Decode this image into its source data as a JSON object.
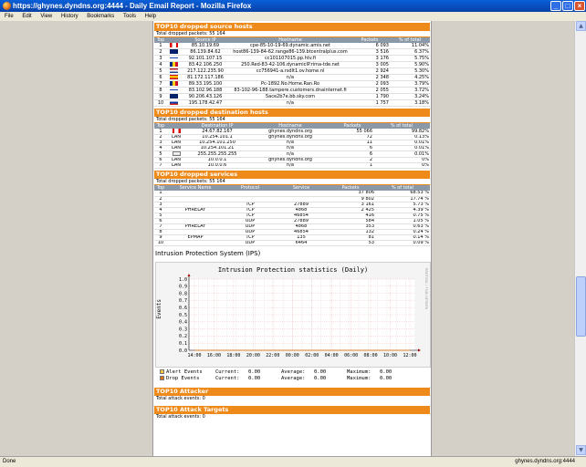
{
  "window": {
    "title": "https://ghynes.dyndns.org:4444 - Daily Email Report - Mozilla Firefox"
  },
  "menu": [
    "File",
    "Edit",
    "View",
    "History",
    "Bookmarks",
    "Tools",
    "Help"
  ],
  "status": {
    "left": "Done",
    "right": "ghynes.dyndns.org:4444"
  },
  "sources": {
    "header": "TOP10 dropped source hosts",
    "total": "Total dropped packets: 55 164",
    "columns": [
      "Top",
      "",
      "Source IP",
      "Hostname",
      "Packets",
      "% of total"
    ],
    "rows": [
      {
        "n": "1",
        "flag": "ca",
        "ip": "85.10.19.69",
        "host": "cpe-85-10-19-69.dynamic.amis.net",
        "p": "6 093",
        "pc": "11.04%"
      },
      {
        "n": "2",
        "flag": "gb",
        "ip": "86.139.84.62",
        "host": "host86-139-84-62.range86-139.btcentralplus.com",
        "p": "3 516",
        "pc": "6.37%"
      },
      {
        "n": "3",
        "flag": "fi",
        "ip": "92.101.107.15",
        "host": "cc101107015.pp.htv.fi",
        "p": "3 176",
        "pc": "5.75%"
      },
      {
        "n": "4",
        "flag": "ro",
        "ip": "83.42.106.250",
        "host": "250.Red-83-42-106.dynamicIP.rima-tde.net",
        "p": "3 005",
        "pc": "5.90%"
      },
      {
        "n": "5",
        "flag": "nl",
        "ip": "217.122.235.90",
        "host": "cc756941-a.rsdlt1.ov.home.nl",
        "p": "2 924",
        "p2": "",
        "pc": "5.30%"
      },
      {
        "n": "6",
        "flag": "es",
        "ip": "81.172.117.186",
        "host": "n/a",
        "p": "2 348",
        "pc": "4.25%"
      },
      {
        "n": "7",
        "flag": "ro",
        "ip": "89.33.195.100",
        "host": "Pc-1892.No.Home.Ran.Ro",
        "p": "2 093",
        "pc": "3.79%"
      },
      {
        "n": "8",
        "flag": "fi",
        "ip": "83.102.96.188",
        "host": "83-102-96-188.tampere.customers.dnainternet.fi",
        "p": "2 055",
        "pc": "3.72%"
      },
      {
        "n": "9",
        "flag": "gb",
        "ip": "90.206.43.126",
        "host": "5ace2b7e.bb.sky.com",
        "p": "1 790",
        "pc": "3.24%"
      },
      {
        "n": "10",
        "flag": "ru",
        "ip": "195.178.42.47",
        "host": "n/a",
        "p": "1 757",
        "pc": "3.18%"
      }
    ]
  },
  "dests": {
    "header": "TOP10 dropped destination hosts",
    "total": "Total dropped packets: 55 164",
    "columns": [
      "Top",
      "",
      "Destination IP",
      "Hostname",
      "Packets",
      "% of total"
    ],
    "rows": [
      {
        "n": "1",
        "flag": "ca",
        "ip": "24.67.82.167",
        "host": "ghynes.dyndns.org",
        "p": "55 066",
        "pc": "99.82%"
      },
      {
        "n": "2",
        "flag": "LAN",
        "ip": "10.254.101.1",
        "host": "ghynes.dyndns.org",
        "p": "72",
        "pc": "0.13%"
      },
      {
        "n": "3",
        "flag": "LAN",
        "ip": "10.254.101.250",
        "host": "n/a",
        "p": "11",
        "pc": "0.01%"
      },
      {
        "n": "4",
        "flag": "LAN",
        "ip": "10.254.101.21",
        "host": "n/a",
        "p": "6",
        "pc": "0.01%"
      },
      {
        "n": "5",
        "flag": "generic",
        "ip": "255.255.255.255",
        "host": "n/a",
        "p": "6",
        "pc": "0.01%"
      },
      {
        "n": "6",
        "flag": "LAN",
        "ip": "10.0.0.1",
        "host": "ghynes.dyndns.org",
        "p": "2",
        "pc": "0%"
      },
      {
        "n": "7",
        "flag": "LAN",
        "ip": "10.0.0.6",
        "host": "n/a",
        "p": "1",
        "pc": "0%"
      }
    ]
  },
  "services": {
    "header": "TOP10 dropped services",
    "total": "Total dropped packets: 55 164",
    "columns": [
      "Top",
      "Service Name",
      "Protocol",
      "Service",
      "Packets",
      "% of total"
    ],
    "rows": [
      {
        "n": "1",
        "name": "",
        "proto": "",
        "svc": "",
        "p": "37 806",
        "pc": "68.53 %"
      },
      {
        "n": "2",
        "name": "",
        "proto": "",
        "svc": "",
        "p": "9 802",
        "pc": "17.74 %"
      },
      {
        "n": "3",
        "name": "",
        "proto": "TCP",
        "svc": "27889",
        "p": "3 161",
        "pc": "5.73 %"
      },
      {
        "n": "4",
        "name": "PHRELAY",
        "proto": "TCP",
        "svc": "4868",
        "p": "2 425",
        "pc": "4.39 %"
      },
      {
        "n": "5",
        "name": "",
        "proto": "TCP",
        "svc": "46854",
        "p": "416",
        "pc": "0.75 %"
      },
      {
        "n": "6",
        "name": "",
        "proto": "UDP",
        "svc": "27889",
        "p": "584",
        "pc": "1.05 %"
      },
      {
        "n": "7",
        "name": "PHRELAY",
        "proto": "UDP",
        "svc": "4868",
        "p": "353",
        "pc": "0.63 %"
      },
      {
        "n": "8",
        "name": "",
        "proto": "UDP",
        "svc": "46854",
        "p": "132",
        "pc": "0.24 %"
      },
      {
        "n": "9",
        "name": "EPMAP",
        "proto": "TCP",
        "svc": "135",
        "p": "81",
        "pc": "0.14 %"
      },
      {
        "n": "10",
        "name": "",
        "proto": "UDP",
        "svc": "6464",
        "p": "53",
        "pc": "0.09 %"
      }
    ]
  },
  "ips": {
    "caption": "Intrusion Protection System (IPS)"
  },
  "chart_data": {
    "type": "line",
    "title": "Intrusion Protection statistics (Daily)",
    "ylabel": "Events",
    "side_label": "RRDTOOL / TOBI OETIKER",
    "x": [
      "14:00",
      "16:00",
      "18:00",
      "20:00",
      "22:00",
      "00:00",
      "02:00",
      "04:00",
      "06:00",
      "08:00",
      "10:00",
      "12:00"
    ],
    "yticks": [
      "1.0",
      "0.9",
      "0.8",
      "0.7",
      "0.6",
      "0.5",
      "0.4",
      "0.3",
      "0.2",
      "0.1",
      "0.0"
    ],
    "ylim": [
      0,
      1
    ],
    "series": [
      {
        "name": "Alert Events",
        "color": "#f5c542",
        "values": [
          0,
          0,
          0,
          0,
          0,
          0,
          0,
          0,
          0,
          0,
          0,
          0
        ]
      },
      {
        "name": "Drop Events",
        "color": "#d9741c",
        "values": [
          0,
          0,
          0,
          0,
          0,
          0,
          0,
          0,
          0,
          0,
          0,
          0
        ]
      }
    ],
    "legend": [
      {
        "name": "Alert Events",
        "color": "#f5c542",
        "current": "0.00",
        "average": "0.00",
        "maximum": "0.00"
      },
      {
        "name": "Drop Events",
        "color": "#d9741c",
        "current": "0.00",
        "average": "0.00",
        "maximum": "0.00"
      }
    ],
    "labels": {
      "current": "Current:",
      "average": "Average:",
      "maximum": "Maximum:"
    }
  },
  "attacker": {
    "header": "TOP10 Attacker",
    "total": "Total attack events: 0"
  },
  "targets": {
    "header": "TOP10 Attack Targets",
    "total": "Total attack events: 0"
  },
  "colors": {
    "accent": "#ee8a1a",
    "table_header": "#8b98a8"
  }
}
